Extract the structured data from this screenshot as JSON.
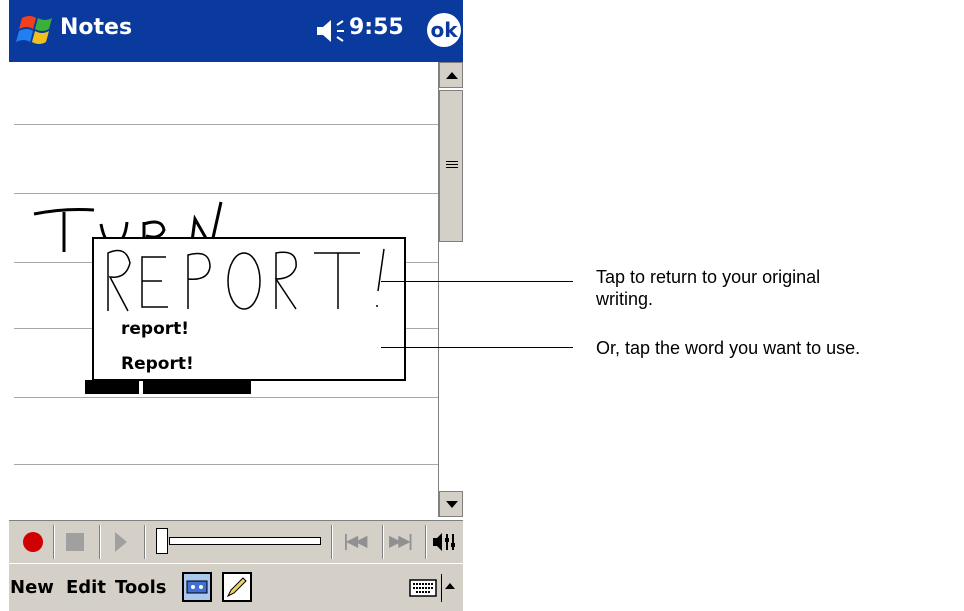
{
  "titlebar": {
    "app_title": "Notes",
    "clock": "9:55",
    "ok_label": "ok"
  },
  "popup": {
    "handwriting": "REPORT!",
    "suggestions": [
      "report!",
      "Report!"
    ]
  },
  "menubar": {
    "items": [
      "New",
      "Edit",
      "Tools"
    ]
  },
  "callouts": [
    {
      "line1": "Tap to return to your original",
      "line2": "writing."
    },
    {
      "line1": "Or, tap the word you want to use."
    }
  ],
  "colors": {
    "titlebar": "#0b3a9e",
    "chrome": "#d4d0c8",
    "record": "#d00000"
  }
}
